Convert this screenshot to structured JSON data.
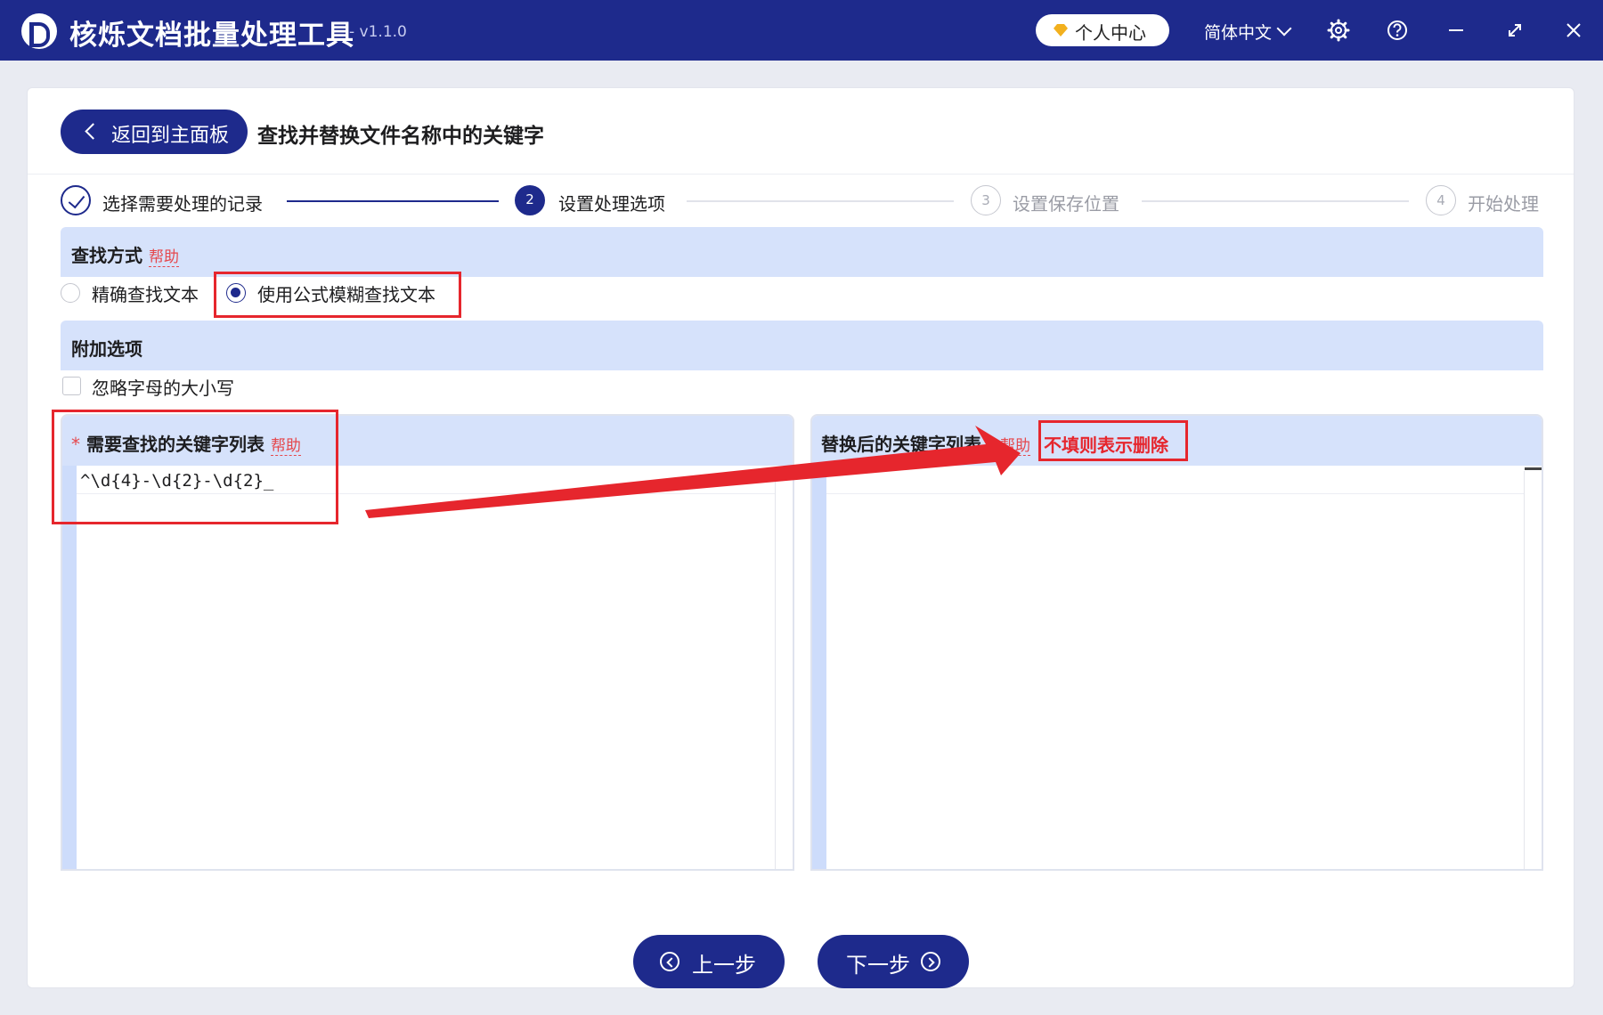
{
  "app": {
    "title": "核烁文档批量处理工具",
    "version": "- v1.1.0",
    "user_center": "个人中心",
    "language": "简体中文"
  },
  "header": {
    "back_label": "返回到主面板",
    "page_title": "查找并替换文件名称中的关键字"
  },
  "steps": [
    {
      "number": "1",
      "label": "选择需要处理的记录",
      "state": "done"
    },
    {
      "number": "2",
      "label": "设置处理选项",
      "state": "active"
    },
    {
      "number": "3",
      "label": "设置保存位置",
      "state": "todo"
    },
    {
      "number": "4",
      "label": "开始处理",
      "state": "todo"
    }
  ],
  "find_mode": {
    "title": "查找方式",
    "help": "帮助",
    "options": [
      {
        "label": "精确查找文本",
        "selected": false
      },
      {
        "label": "使用公式模糊查找文本",
        "selected": true
      }
    ]
  },
  "extra": {
    "title": "附加选项",
    "ignore_case": {
      "label": "忽略字母的大小写",
      "checked": false
    }
  },
  "find_list": {
    "required_mark": "*",
    "title": "需要查找的关键字列表",
    "help": "帮助",
    "content": "^\\d{4}-\\d{2}-\\d{2}_"
  },
  "replace_list": {
    "title": "替换后的关键字列表",
    "help": "帮助",
    "note": "不填则表示删除",
    "content": ""
  },
  "nav": {
    "prev": "上一步",
    "next": "下一步"
  },
  "colors": {
    "brand": "#1e2a8c",
    "section_bg": "#d6e2fb",
    "annotation_red": "#e6262d",
    "help_link": "#e5484d"
  }
}
